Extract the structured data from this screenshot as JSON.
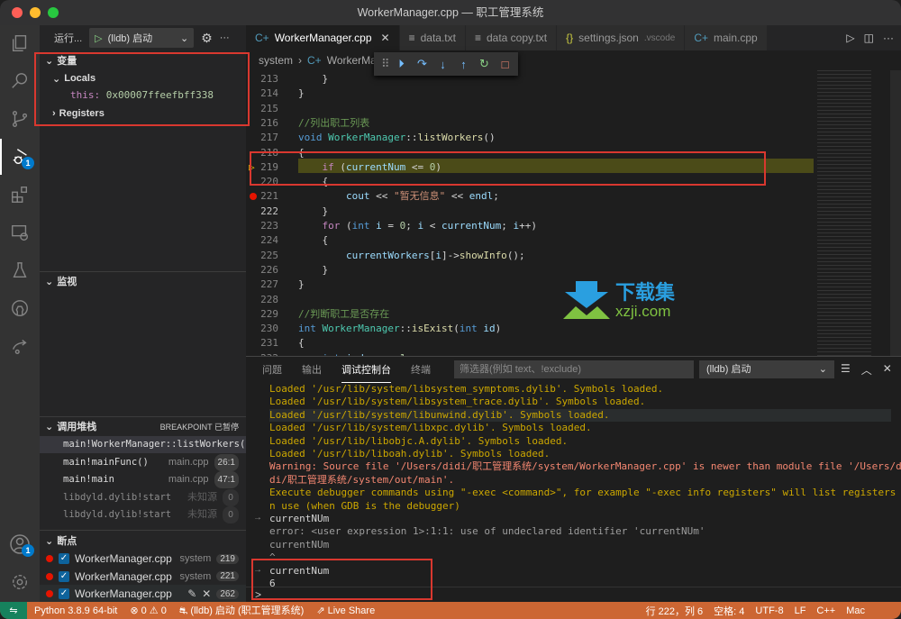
{
  "window": {
    "title": "WorkerManager.cpp — 职工管理系统"
  },
  "activity_bar": {
    "debug_badge": "1",
    "accounts_badge": "1"
  },
  "sidebar": {
    "run_label": "运行...",
    "launch_config": "(lldb) 启动",
    "variables": {
      "title": "变量",
      "locals_label": "Locals",
      "this_name": "this:",
      "this_value": "0x00007ffeefbff338",
      "registers_label": "Registers"
    },
    "watch": {
      "title": "监视"
    },
    "call_stack": {
      "title": "调用堆栈",
      "status": "BREAKPOINT 已暂停",
      "frames": [
        {
          "fn": "main!WorkerManager::listWorkers()",
          "src": "",
          "pos": ""
        },
        {
          "fn": "main!mainFunc()",
          "src": "main.cpp",
          "pos": "26:1"
        },
        {
          "fn": "main!main",
          "src": "main.cpp",
          "pos": "47:1"
        },
        {
          "fn": "libdyld.dylib!start",
          "src": "未知源",
          "pos": "0"
        },
        {
          "fn": "libdyld.dylib!start",
          "src": "未知源",
          "pos": "0"
        }
      ]
    },
    "breakpoints": {
      "title": "断点",
      "items": [
        {
          "file": "WorkerManager.cpp",
          "folder": "system",
          "line": "219"
        },
        {
          "file": "WorkerManager.cpp",
          "folder": "system",
          "line": "221"
        },
        {
          "file": "WorkerManager.cpp",
          "folder": "",
          "line": "262"
        }
      ]
    }
  },
  "tabs": [
    {
      "label": "WorkerManager.cpp",
      "icon": "C+"
    },
    {
      "label": "data.txt",
      "icon": "≡"
    },
    {
      "label": "data copy.txt",
      "icon": "≡"
    },
    {
      "label": "settings.json",
      "desc": ".vscode",
      "icon": "{}"
    },
    {
      "label": "main.cpp",
      "icon": "C+"
    }
  ],
  "breadcrumb": {
    "folder": "system",
    "file": "WorkerMa"
  },
  "editor": {
    "lines": [
      "213",
      "214",
      "215",
      "216",
      "217",
      "218",
      "219",
      "220",
      "221",
      "222",
      "223",
      "224",
      "225",
      "226",
      "227",
      "228",
      "229",
      "230",
      "231",
      "232"
    ],
    "comment1": "//列出职工列表",
    "comment2": "//判断职工是否存在",
    "string1": "\"暂无信息\""
  },
  "watermark": {
    "cn": "下载集",
    "en": "xzji.com"
  },
  "panel": {
    "tabs": [
      "问题",
      "输出",
      "调试控制台",
      "终端"
    ],
    "filter_placeholder": "筛选器(例如 text、!exclude)",
    "session": "(lldb) 启动",
    "console": [
      {
        "text": "Loaded '/usr/lib/system/libsystem_symptoms.dylib'. Symbols loaded.",
        "type": "load"
      },
      {
        "text": "Loaded '/usr/lib/system/libsystem_trace.dylib'. Symbols loaded.",
        "type": "load"
      },
      {
        "text": "Loaded '/usr/lib/system/libunwind.dylib'. Symbols loaded.",
        "type": "load"
      },
      {
        "text": "Loaded '/usr/lib/system/libxpc.dylib'. Symbols loaded.",
        "type": "load"
      },
      {
        "text": "Loaded '/usr/lib/libobjc.A.dylib'. Symbols loaded.",
        "type": "load"
      },
      {
        "text": "Loaded '/usr/lib/liboah.dylib'. Symbols loaded.",
        "type": "load"
      },
      {
        "text": "Warning: Source file '/Users/didi/职工管理系统/system/WorkerManager.cpp' is newer than module file '/Users/di",
        "type": "warn"
      },
      {
        "text": "di/职工管理系统/system/out/main'.",
        "type": "warn"
      },
      {
        "text": "Execute debugger commands using \"-exec <command>\", for example \"-exec info registers\" will list registers i",
        "type": "load"
      },
      {
        "text": "n use (when GDB is the debugger)",
        "type": "load"
      },
      {
        "text": "currentNUm",
        "type": "input"
      },
      {
        "text": "error: <user expression 1>:1:1: use of undeclared identifier 'currentNUm'",
        "type": "err"
      },
      {
        "text": "currentNUm",
        "type": "err"
      },
      {
        "text": "^",
        "type": "err"
      },
      {
        "text": "currentNum",
        "type": "input"
      },
      {
        "text": "6",
        "type": "result"
      }
    ],
    "prompt": ">"
  },
  "statusbar": {
    "python": "Python 3.8.9 64-bit",
    "errors": "0",
    "warnings": "0",
    "debug": "(lldb) 启动 (职工管理系统)",
    "liveshare": "Live Share",
    "position": "行 222，列 6",
    "spaces": "空格: 4",
    "encoding": "UTF-8",
    "eol": "LF",
    "lang": "C++",
    "platform": "Mac"
  }
}
